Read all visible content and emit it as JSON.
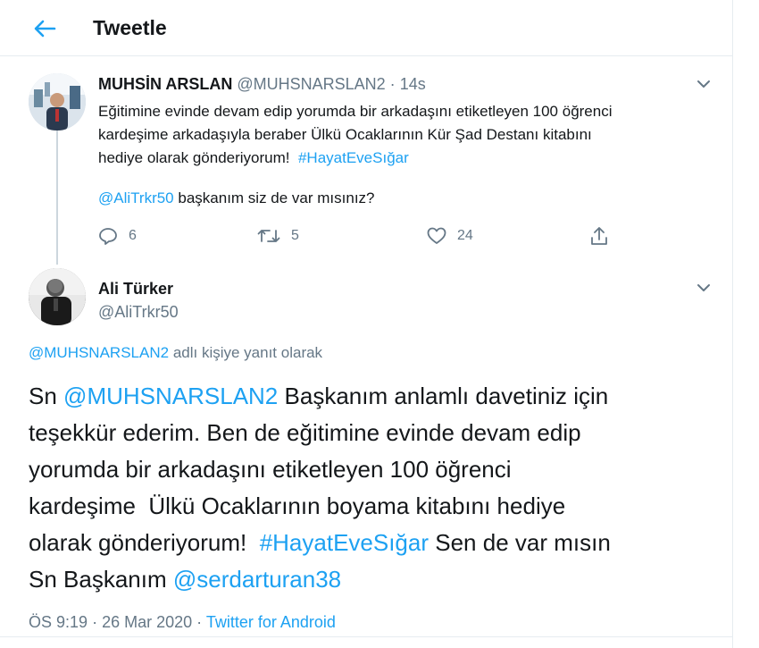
{
  "header": {
    "title": "Tweetle",
    "back_icon": "arrow-left-icon"
  },
  "colors": {
    "accent": "#1da1f2",
    "secondary_text": "#657786",
    "divider": "#e6ecf0"
  },
  "parent_tweet": {
    "name": "MUHSİN ARSLAN",
    "handle": "@MUHSNARSLAN2",
    "sep": "·",
    "time": "14s",
    "lines": [
      "Eğitimine evinde devam edip yorumda bir arkadaşını etiketleyen 100 öğrenci",
      "kardeşime arkadaşıyla beraber Ülkü Ocaklarının Kür Şad Destanı kitabını",
      "hediye olarak gönderiyorum!"
    ],
    "hashtag": "#HayatEveSığar",
    "mention": "@AliTrkr50",
    "mention_text": "başkanım siz de var mısınız?",
    "actions": {
      "reply_count": "6",
      "retweet_count": "5",
      "like_count": "24"
    }
  },
  "reply_tweet": {
    "name": "Ali Türker",
    "handle": "@AliTrkr50",
    "replying_to_handle": "@MUHSNARSLAN2",
    "replying_to_text": "adlı kişiye yanıt olarak",
    "line1_prefix": "Sn",
    "line1_mention": "@MUHSNARSLAN2",
    "line1_rest": "Başkanım anlamlı davetiniz için",
    "line2": "teşekkür ederim. Ben de eğitimine evinde devam edip",
    "line3": "yorumda bir arkadaşını etiketleyen 100 öğrenci",
    "line4": "kardeşime  Ülkü Ocaklarının boyama kitabını hediye",
    "line5_prefix": "olarak gönderiyorum!",
    "line5_hashtag": "#HayatEveSığar",
    "line5_rest": "Sen de var mısın",
    "line6_prefix": "Sn Başkanım",
    "line6_mention": "@serdarturan38",
    "time": "ÖS 9:19",
    "sep": "·",
    "date": "26 Mar 2020",
    "sep2": "·",
    "source": "Twitter for Android"
  }
}
